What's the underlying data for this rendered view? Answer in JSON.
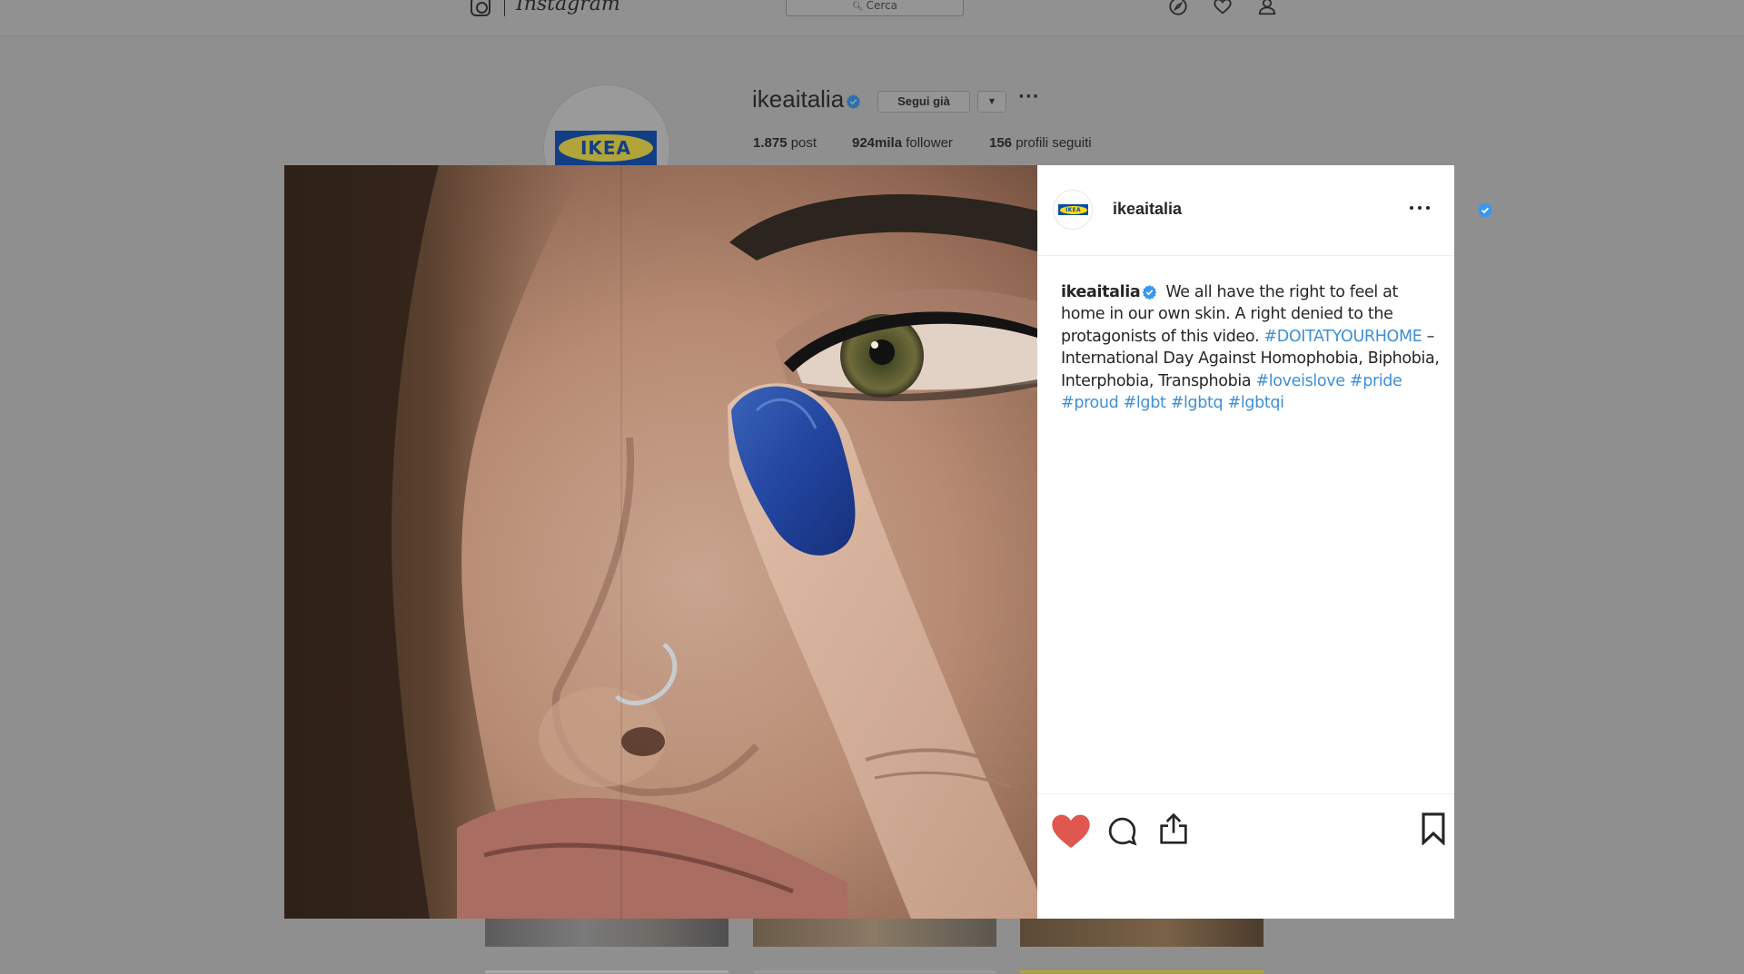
{
  "app": {
    "wordmark": "Instagram",
    "search_placeholder": "Cerca"
  },
  "profile": {
    "username": "ikeaitalia",
    "follow_label": "Segui già",
    "more_label": "···",
    "dropdown_label": "▼",
    "avatar_text": "IKEA",
    "stats": [
      {
        "value": "1.875",
        "label": "post"
      },
      {
        "value": "924mila",
        "label": "follower"
      },
      {
        "value": "156",
        "label": "profili seguiti"
      }
    ]
  },
  "post": {
    "header_username": "ikeaitalia",
    "avatar_text": "IKEA",
    "caption": {
      "username": "ikeaitalia",
      "text_1": "We all have the right to feel at home in our own skin. A right denied to the protagonists of this video.",
      "hashtag_1": "#DOITATYOURHOME",
      "text_2": " – International Day Against Homophobia, Biphobia, Interphobia, Transphobia ",
      "hashtags": [
        "#loveislove",
        "#pride",
        "#proud",
        "#lgbt",
        "#lgbtq",
        "#lgbtqi"
      ]
    },
    "liked": true
  },
  "colors": {
    "verified": "#3897f0",
    "hashtag": "#3f8fd5",
    "like": "#ed4956",
    "ikea_blue": "#0a4ea2",
    "ikea_yellow": "#ffda1a"
  },
  "icons": {
    "top_nav": [
      "compass-icon",
      "heart-icon",
      "user-icon"
    ],
    "actions": [
      "heart-filled-icon",
      "comment-icon",
      "share-icon",
      "bookmark-icon"
    ]
  }
}
